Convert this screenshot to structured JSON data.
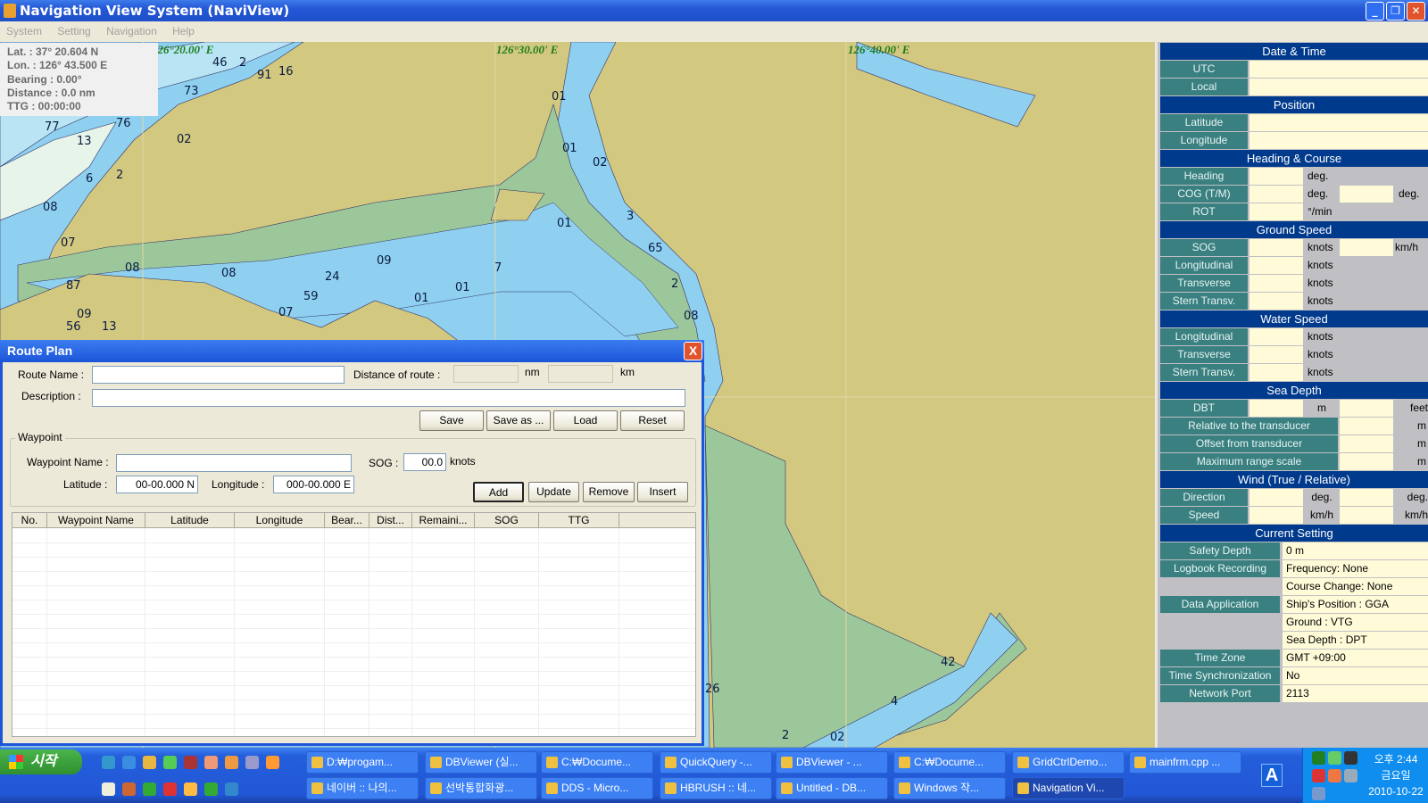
{
  "window": {
    "title": "Navigation View System (NaviView)",
    "minimize": "_",
    "restore": "❐",
    "close": "✕"
  },
  "menu": [
    "System",
    "Setting",
    "Navigation",
    "Help"
  ],
  "info": {
    "lat": "Lat. : 37° 20.604 N",
    "lon": "Lon. : 126° 43.500 E",
    "bearing": "Bearing : 0.00°",
    "distance": "Distance : 0.0 nm",
    "ttg": "TTG : 00:00:00"
  },
  "map": {
    "grid_labels": [
      "126°20.00' E",
      "126°30.00' E",
      "126°40.00' E"
    ],
    "soundings": [
      "46",
      "2",
      "91",
      "16",
      "73",
      "76",
      "02",
      "77",
      "13",
      "6",
      "2",
      "08",
      "07",
      "08",
      "08",
      "24",
      "09",
      "59",
      "07",
      "01",
      "01",
      "87",
      "09",
      "56",
      "13",
      "01",
      "01",
      "02",
      "01",
      "3",
      "65",
      "2",
      "08",
      "26",
      "42",
      "4",
      "2",
      "02",
      "7"
    ],
    "colors": {
      "land": "#d3c87f",
      "water": "#8fd0f0",
      "shallow": "#b8e4f4",
      "intertidal": "#9cc79b"
    }
  },
  "panel": {
    "sections": {
      "datetime": "Date & Time",
      "position": "Position",
      "heading": "Heading & Course",
      "ground": "Ground Speed",
      "water": "Water Speed",
      "depth": "Sea Depth",
      "wind": "Wind (True / Relative)",
      "current": "Current Setting"
    },
    "labels": {
      "utc": "UTC",
      "local": "Local",
      "latitude": "Latitude",
      "longitude": "Longitude",
      "heading": "Heading",
      "cog": "COG (T/M)",
      "rot": "ROT",
      "sog": "SOG",
      "longitudinal": "Longitudinal",
      "transverse": "Transverse",
      "stern": "Stern Transv.",
      "dbt": "DBT",
      "relative": "Relative to the transducer",
      "offset": "Offset from transducer",
      "maxrange": "Maximum range scale",
      "direction": "Direction",
      "speed": "Speed",
      "safety": "Safety Depth",
      "logbook": "Logbook Recording",
      "dataapp": "Data Application",
      "timezone": "Time Zone",
      "timesync": "Time Synchronization",
      "netport": "Network Port"
    },
    "units": {
      "deg": "deg.",
      "rot": "°/min",
      "knots": "knots",
      "kmh": "km/h",
      "m": "m",
      "feet": "feet"
    },
    "current_values": {
      "safety": "0 m",
      "frequency": "Frequency: None",
      "course_change": "Course Change: None",
      "ships_position": "Ship's Position : GGA",
      "ground": "Ground : VTG",
      "sea_depth": "Sea Depth : DPT",
      "timezone": "GMT +09:00",
      "timesync": "No",
      "netport": "2113"
    }
  },
  "route_plan": {
    "title": "Route Plan",
    "close": "X",
    "route_name_label": "Route Name :",
    "route_name": "",
    "distance_label": "Distance of route :",
    "distance_nm": "",
    "nm": "nm",
    "distance_km": "",
    "km": "km",
    "description_label": "Description :",
    "description": "",
    "buttons": {
      "save": "Save",
      "save_as": "Save as ...",
      "load": "Load",
      "reset": "Reset",
      "add": "Add",
      "update": "Update",
      "remove": "Remove",
      "insert": "Insert"
    },
    "waypoint_group": "Waypoint",
    "waypoint_name_label": "Waypoint Name :",
    "waypoint_name": "",
    "sog_label": "SOG :",
    "sog": "00.0",
    "knots": "knots",
    "latitude_label": "Latitude :",
    "latitude": "00-00.000 N",
    "longitude_label": "Longitude :",
    "longitude": "000-00.000 E",
    "columns": [
      "No.",
      "Waypoint Name",
      "Latitude",
      "Longitude",
      "Bear...",
      "Dist...",
      "Remaini...",
      "SOG",
      "TTG",
      ""
    ],
    "rows": []
  },
  "taskbar": {
    "start": "시작",
    "tasks_row1": [
      "D:₩progam...",
      "DBViewer (실...",
      "C:₩Docume...",
      "QuickQuery -...",
      "DBViewer - ...",
      "C:₩Docume...",
      "GridCtrlDemo...",
      "mainfrm.cpp ..."
    ],
    "tasks_row2": [
      "네이버 :: 나의...",
      "선박통합화광...",
      "DDS - Micro...",
      "HBRUSH :: 네...",
      "Untitled - DB...",
      "Windows 작...",
      "Navigation Vi..."
    ],
    "language": "A",
    "clock": {
      "time": "오후 2:44",
      "day": "금요일",
      "date": "2010-10-22"
    }
  }
}
